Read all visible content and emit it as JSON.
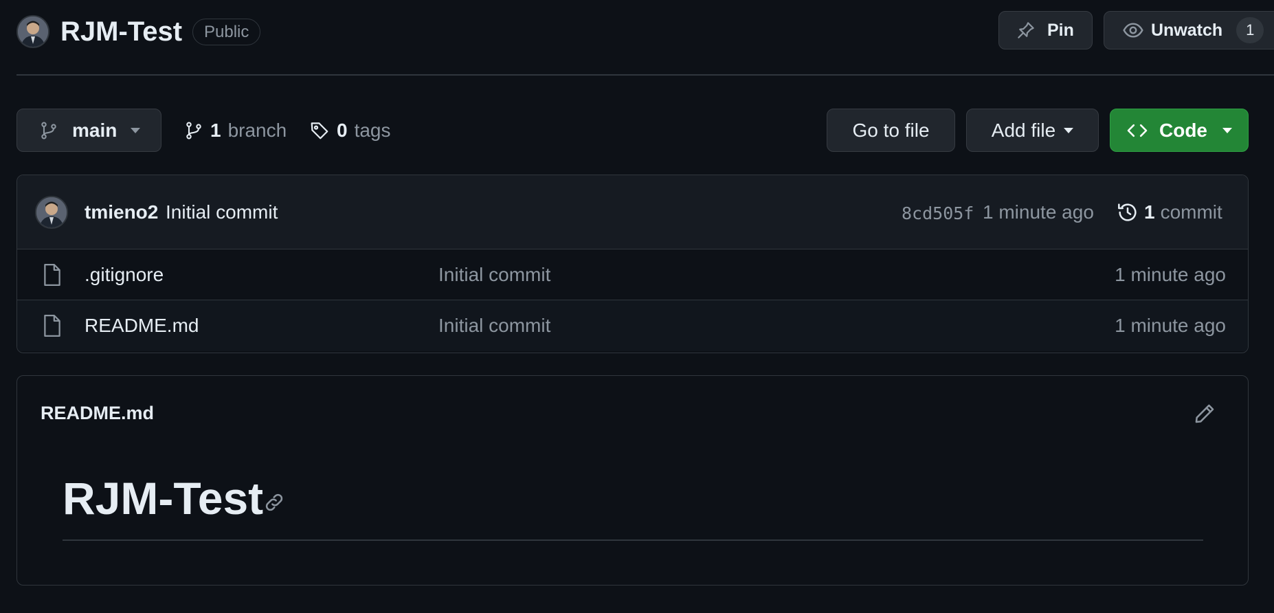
{
  "repo": {
    "name": "RJM-Test",
    "visibility": "Public"
  },
  "header_actions": {
    "pin_label": "Pin",
    "unwatch_label": "Unwatch",
    "watch_count": "1"
  },
  "toolbar": {
    "branch": "main",
    "branch_count": "1",
    "branch_word": "branch",
    "tag_count": "0",
    "tag_word": "tags",
    "goto_label": "Go to file",
    "addfile_label": "Add file",
    "code_label": "Code"
  },
  "latest_commit": {
    "author": "tmieno2",
    "message": "Initial commit",
    "sha": "8cd505f",
    "time": "1 minute ago",
    "commit_count": "1",
    "commit_word": "commit"
  },
  "files": [
    {
      "name": ".gitignore",
      "commit_message": "Initial commit",
      "time": "1 minute ago",
      "icon": "file-icon"
    },
    {
      "name": "README.md",
      "commit_message": "Initial commit",
      "time": "1 minute ago",
      "icon": "file-icon"
    }
  ],
  "readme": {
    "label": "README.md",
    "heading": "RJM-Test"
  },
  "colors": {
    "background": "#0d1117",
    "border": "#30363d",
    "button": "#21262d",
    "primary_button": "#238636",
    "muted_text": "#8d96a0",
    "text": "#e6edf3"
  }
}
